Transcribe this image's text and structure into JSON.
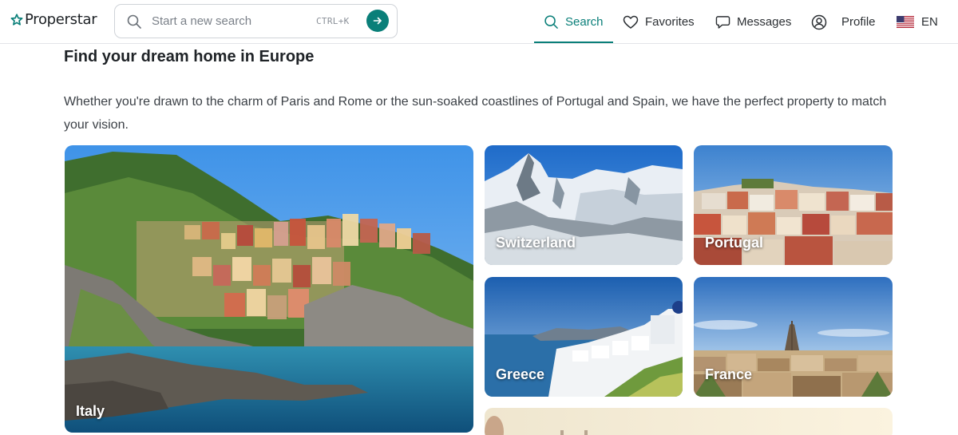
{
  "brand": {
    "name": "Properstar"
  },
  "search": {
    "placeholder": "Start a new search",
    "shortcut": "CTRL+K"
  },
  "nav": [
    {
      "label": "Search",
      "icon": "search-icon",
      "active": true
    },
    {
      "label": "Favorites",
      "icon": "heart-icon"
    },
    {
      "label": "Messages",
      "icon": "chat-bubble-icon"
    },
    {
      "label": "Profile",
      "icon": "user-icon"
    },
    {
      "label": "EN",
      "icon": "us-flag-icon"
    }
  ],
  "main": {
    "title": "Find your dream home in Europe",
    "intro": "Whether you're drawn to the charm of Paris and Rome or the sun-soaked coastlines of Portugal and Spain, we have the perfect property to match your vision.",
    "destinations": [
      {
        "label": "Italy"
      },
      {
        "label": "Switzerland"
      },
      {
        "label": "Portugal"
      },
      {
        "label": "Greece"
      },
      {
        "label": "France"
      }
    ]
  },
  "colors": {
    "accent": "#0a7f79",
    "border": "#e3e5e8"
  }
}
